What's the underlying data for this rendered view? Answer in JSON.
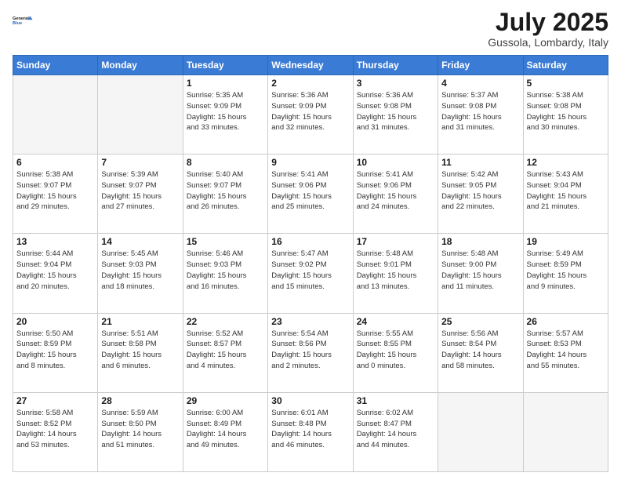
{
  "header": {
    "logo_line1": "General",
    "logo_line2": "Blue",
    "month": "July 2025",
    "location": "Gussola, Lombardy, Italy"
  },
  "weekdays": [
    "Sunday",
    "Monday",
    "Tuesday",
    "Wednesday",
    "Thursday",
    "Friday",
    "Saturday"
  ],
  "weeks": [
    [
      {
        "day": "",
        "info": ""
      },
      {
        "day": "",
        "info": ""
      },
      {
        "day": "1",
        "info": "Sunrise: 5:35 AM\nSunset: 9:09 PM\nDaylight: 15 hours\nand 33 minutes."
      },
      {
        "day": "2",
        "info": "Sunrise: 5:36 AM\nSunset: 9:09 PM\nDaylight: 15 hours\nand 32 minutes."
      },
      {
        "day": "3",
        "info": "Sunrise: 5:36 AM\nSunset: 9:08 PM\nDaylight: 15 hours\nand 31 minutes."
      },
      {
        "day": "4",
        "info": "Sunrise: 5:37 AM\nSunset: 9:08 PM\nDaylight: 15 hours\nand 31 minutes."
      },
      {
        "day": "5",
        "info": "Sunrise: 5:38 AM\nSunset: 9:08 PM\nDaylight: 15 hours\nand 30 minutes."
      }
    ],
    [
      {
        "day": "6",
        "info": "Sunrise: 5:38 AM\nSunset: 9:07 PM\nDaylight: 15 hours\nand 29 minutes."
      },
      {
        "day": "7",
        "info": "Sunrise: 5:39 AM\nSunset: 9:07 PM\nDaylight: 15 hours\nand 27 minutes."
      },
      {
        "day": "8",
        "info": "Sunrise: 5:40 AM\nSunset: 9:07 PM\nDaylight: 15 hours\nand 26 minutes."
      },
      {
        "day": "9",
        "info": "Sunrise: 5:41 AM\nSunset: 9:06 PM\nDaylight: 15 hours\nand 25 minutes."
      },
      {
        "day": "10",
        "info": "Sunrise: 5:41 AM\nSunset: 9:06 PM\nDaylight: 15 hours\nand 24 minutes."
      },
      {
        "day": "11",
        "info": "Sunrise: 5:42 AM\nSunset: 9:05 PM\nDaylight: 15 hours\nand 22 minutes."
      },
      {
        "day": "12",
        "info": "Sunrise: 5:43 AM\nSunset: 9:04 PM\nDaylight: 15 hours\nand 21 minutes."
      }
    ],
    [
      {
        "day": "13",
        "info": "Sunrise: 5:44 AM\nSunset: 9:04 PM\nDaylight: 15 hours\nand 20 minutes."
      },
      {
        "day": "14",
        "info": "Sunrise: 5:45 AM\nSunset: 9:03 PM\nDaylight: 15 hours\nand 18 minutes."
      },
      {
        "day": "15",
        "info": "Sunrise: 5:46 AM\nSunset: 9:03 PM\nDaylight: 15 hours\nand 16 minutes."
      },
      {
        "day": "16",
        "info": "Sunrise: 5:47 AM\nSunset: 9:02 PM\nDaylight: 15 hours\nand 15 minutes."
      },
      {
        "day": "17",
        "info": "Sunrise: 5:48 AM\nSunset: 9:01 PM\nDaylight: 15 hours\nand 13 minutes."
      },
      {
        "day": "18",
        "info": "Sunrise: 5:48 AM\nSunset: 9:00 PM\nDaylight: 15 hours\nand 11 minutes."
      },
      {
        "day": "19",
        "info": "Sunrise: 5:49 AM\nSunset: 8:59 PM\nDaylight: 15 hours\nand 9 minutes."
      }
    ],
    [
      {
        "day": "20",
        "info": "Sunrise: 5:50 AM\nSunset: 8:59 PM\nDaylight: 15 hours\nand 8 minutes."
      },
      {
        "day": "21",
        "info": "Sunrise: 5:51 AM\nSunset: 8:58 PM\nDaylight: 15 hours\nand 6 minutes."
      },
      {
        "day": "22",
        "info": "Sunrise: 5:52 AM\nSunset: 8:57 PM\nDaylight: 15 hours\nand 4 minutes."
      },
      {
        "day": "23",
        "info": "Sunrise: 5:54 AM\nSunset: 8:56 PM\nDaylight: 15 hours\nand 2 minutes."
      },
      {
        "day": "24",
        "info": "Sunrise: 5:55 AM\nSunset: 8:55 PM\nDaylight: 15 hours\nand 0 minutes."
      },
      {
        "day": "25",
        "info": "Sunrise: 5:56 AM\nSunset: 8:54 PM\nDaylight: 14 hours\nand 58 minutes."
      },
      {
        "day": "26",
        "info": "Sunrise: 5:57 AM\nSunset: 8:53 PM\nDaylight: 14 hours\nand 55 minutes."
      }
    ],
    [
      {
        "day": "27",
        "info": "Sunrise: 5:58 AM\nSunset: 8:52 PM\nDaylight: 14 hours\nand 53 minutes."
      },
      {
        "day": "28",
        "info": "Sunrise: 5:59 AM\nSunset: 8:50 PM\nDaylight: 14 hours\nand 51 minutes."
      },
      {
        "day": "29",
        "info": "Sunrise: 6:00 AM\nSunset: 8:49 PM\nDaylight: 14 hours\nand 49 minutes."
      },
      {
        "day": "30",
        "info": "Sunrise: 6:01 AM\nSunset: 8:48 PM\nDaylight: 14 hours\nand 46 minutes."
      },
      {
        "day": "31",
        "info": "Sunrise: 6:02 AM\nSunset: 8:47 PM\nDaylight: 14 hours\nand 44 minutes."
      },
      {
        "day": "",
        "info": ""
      },
      {
        "day": "",
        "info": ""
      }
    ]
  ]
}
